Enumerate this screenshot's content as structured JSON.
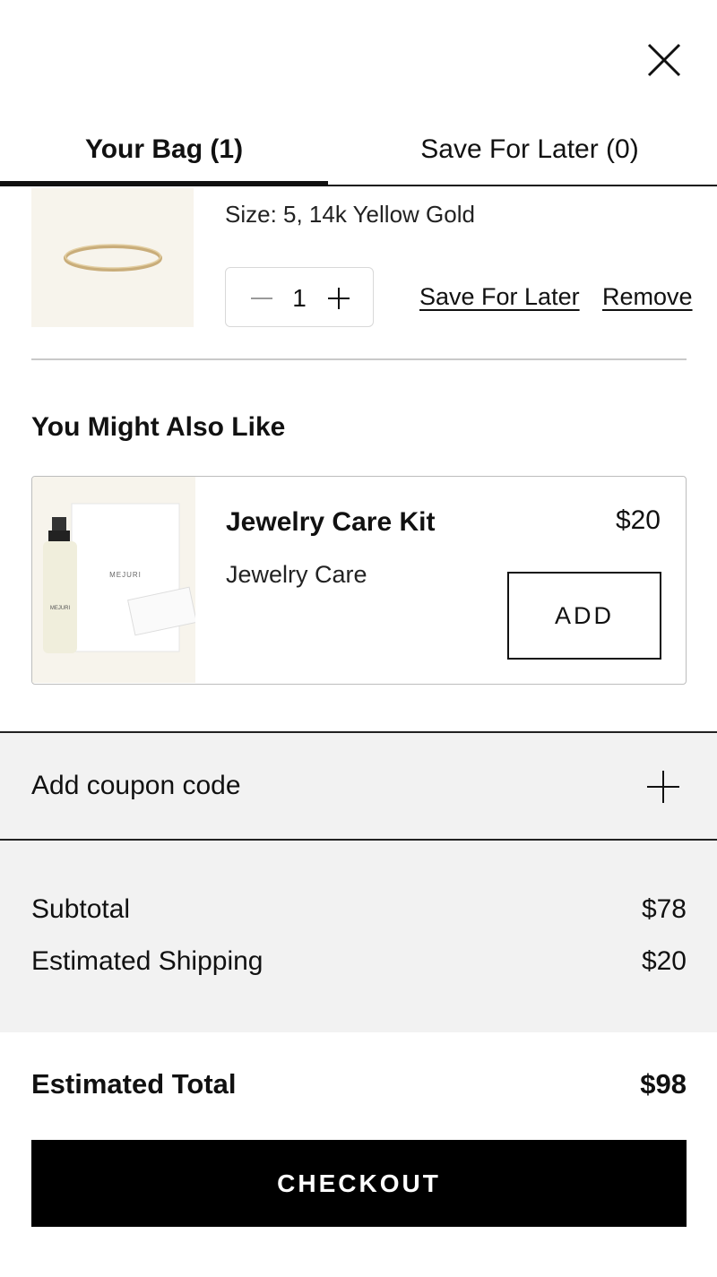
{
  "header": {
    "close_icon": "close-icon"
  },
  "tabs": [
    {
      "label": "Your Bag (1)",
      "active": true
    },
    {
      "label": "Save For Later (0)",
      "active": false
    }
  ],
  "cart_item": {
    "image": "gold-ring-image",
    "size": "Size: 5, 14k Yellow Gold",
    "quantity": "1",
    "save_for_later_label": "Save For Later",
    "remove_label": "Remove"
  },
  "recommendations": {
    "title": "You Might Also Like",
    "items": [
      {
        "name": "Jewelry Care Kit",
        "category": "Jewelry Care",
        "price": "$20",
        "add_label": "ADD",
        "image_brand_text": "MEJURI"
      }
    ]
  },
  "coupon": {
    "label": "Add coupon code"
  },
  "summary": {
    "subtotal_label": "Subtotal",
    "subtotal_value": "$78",
    "shipping_label": "Estimated Shipping",
    "shipping_value": "$20",
    "total_label": "Estimated Total",
    "total_value": "$98"
  },
  "checkout_label": "CHECKOUT",
  "colors": {
    "accent": "#000000",
    "panel_bg": "#f2f2f2",
    "thumb_bg": "#f7f4ec",
    "ring_gold": "#c9ad7a"
  }
}
